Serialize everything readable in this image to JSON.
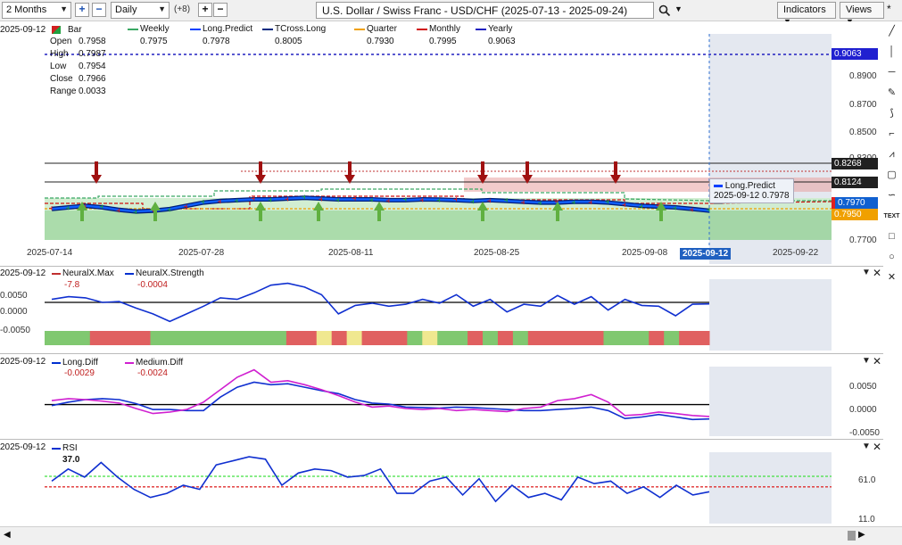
{
  "toolbar": {
    "range": "2 Months",
    "interval": "Daily",
    "offset": "(+8)",
    "symbol": "U.S. Dollar / Swiss Franc - USD/CHF (2025-07-13 - 2025-09-24)",
    "indicators": "Indicators",
    "views": "Views"
  },
  "main_pane": {
    "date": "2025-09-12",
    "bar_label": "Bar",
    "ohlc": [
      {
        "label": "Open",
        "value": "0.7958"
      },
      {
        "label": "High",
        "value": "0.7987"
      },
      {
        "label": "Low",
        "value": "0.7954"
      },
      {
        "label": "Close",
        "value": "0.7966"
      },
      {
        "label": "Range",
        "value": "0.0033"
      }
    ],
    "indicators": [
      {
        "name": "Weekly",
        "value": "0.7975",
        "color": "#3aa864"
      },
      {
        "name": "Long.Predict",
        "value": "0.7978",
        "color": "#0040ff"
      },
      {
        "name": "TCross.Long",
        "value": "0.8005",
        "color": "#002a80"
      },
      {
        "name": "Quarter",
        "value": "0.7930",
        "color": "#f0a000"
      },
      {
        "name": "Monthly",
        "value": "0.7995",
        "color": "#d01010"
      },
      {
        "name": "Yearly",
        "value": "0.9063",
        "color": "#2020c0"
      }
    ],
    "price_axis": [
      "0.8900",
      "0.8700",
      "0.8500",
      "0.8300",
      "0.7700"
    ],
    "price_tags": [
      {
        "value": "0.9063",
        "color": "#2020d0"
      },
      {
        "value": "0.8268",
        "color": "#202020"
      },
      {
        "value": "0.8124",
        "color": "#202020"
      },
      {
        "value": "0.7970",
        "color": "#1060d0"
      },
      {
        "value": "0.7950",
        "color": "#f0a000"
      }
    ],
    "dates": [
      "2025-07-14",
      "2025-07-28",
      "2025-08-11",
      "2025-08-25",
      "2025-09-08",
      "2025-09-12",
      "2025-09-22"
    ],
    "tooltip": {
      "name": "Long.Predict",
      "date": "2025-09-12",
      "value": "0.7978"
    }
  },
  "pane2": {
    "date": "2025-09-12",
    "legends": [
      {
        "name": "NeuralX.Max",
        "value": "-7.8",
        "color": "#c03030"
      },
      {
        "name": "NeuralX.Strength",
        "value": "-0.0004",
        "color": "#0030d0"
      }
    ],
    "axis": [
      "0.0050",
      "0.0000",
      "-0.0050"
    ]
  },
  "pane3": {
    "date": "2025-09-12",
    "legends": [
      {
        "name": "Long.Diff",
        "value": "-0.0029",
        "color": "#0030d0"
      },
      {
        "name": "Medium.Diff",
        "value": "-0.0024",
        "color": "#d020d0"
      }
    ],
    "axis": [
      "0.0050",
      "0.0000",
      "-0.0050"
    ]
  },
  "pane4": {
    "date": "2025-09-12",
    "legends": [
      {
        "name": "RSI",
        "value": "37.0",
        "color": "#0030d0"
      }
    ],
    "axis": [
      "61.0",
      "11.0"
    ]
  },
  "chart_data": [
    {
      "type": "line",
      "title": "U.S. Dollar / Swiss Franc - USD/CHF (2025-07-13 - 2025-09-24)",
      "series": [
        {
          "name": "Long.Predict",
          "values": [
            0.799,
            0.8,
            0.801,
            0.8,
            0.7985,
            0.7975,
            0.798,
            0.799,
            0.801,
            0.803,
            0.804,
            0.8045,
            0.805,
            0.805,
            0.8055,
            0.806,
            0.8055,
            0.805,
            0.805,
            0.805,
            0.8045,
            0.8045,
            0.805,
            0.8048,
            0.8045,
            0.804,
            0.8045,
            0.804,
            0.8035,
            0.803,
            0.803,
            0.8035,
            0.8035,
            0.803,
            0.802,
            0.801,
            0.8005,
            0.8,
            0.799,
            0.798
          ]
        }
      ],
      "reference_lines": {
        "Yearly": 0.9063,
        "upper_black": 0.8268,
        "lower_black": 0.8124
      },
      "ylim": [
        0.77,
        0.91
      ]
    },
    {
      "type": "line",
      "series": [
        {
          "name": "NeuralX.Strength",
          "values": [
            0.0008,
            0.0015,
            0.0012,
            0.0,
            0.0002,
            -0.0015,
            -0.003,
            -0.005,
            -0.003,
            -0.001,
            0.0012,
            0.0008,
            0.0025,
            0.0045,
            0.005,
            0.004,
            0.002,
            -0.003,
            -0.0008,
            -0.0002,
            -0.001,
            -0.0005,
            0.0008,
            -0.0002,
            0.002,
            -0.001,
            0.0008,
            -0.0025,
            -0.0005,
            -0.001,
            0.0018,
            -0.0005,
            0.0015,
            -0.002,
            0.0008,
            -0.0008,
            -0.001,
            -0.0035,
            -0.0005,
            -0.0004
          ]
        },
        {
          "name": "NeuralX.Max",
          "values": []
        }
      ],
      "ylim": [
        -0.007,
        0.007
      ]
    },
    {
      "type": "line",
      "series": [
        {
          "name": "Long.Diff",
          "values": [
            -0.0002,
            0.0005,
            0.001,
            0.0012,
            0.001,
            0.0002,
            -0.001,
            -0.001,
            -0.0012,
            -0.0012,
            0.0015,
            0.0035,
            0.0045,
            0.004,
            0.0042,
            0.0035,
            0.0028,
            0.0022,
            0.001,
            0.0003,
            0.0001,
            -0.0005,
            -0.0006,
            -0.0007,
            -0.0005,
            -0.0006,
            -0.0008,
            -0.001,
            -0.0012,
            -0.0012,
            -0.001,
            -0.0008,
            -0.0005,
            -0.0012,
            -0.0028,
            -0.0025,
            -0.002,
            -0.0025,
            -0.003,
            -0.0029
          ]
        },
        {
          "name": "Medium.Diff",
          "values": [
            0.0008,
            0.0012,
            0.001,
            0.0007,
            0.0003,
            -0.0008,
            -0.0018,
            -0.0015,
            -0.001,
            0.0005,
            0.003,
            0.0055,
            0.007,
            0.0045,
            0.0048,
            0.004,
            0.003,
            0.0018,
            0.0005,
            -0.0005,
            -0.0003,
            -0.0008,
            -0.001,
            -0.0008,
            -0.0012,
            -0.001,
            -0.0012,
            -0.0014,
            -0.0008,
            -0.0005,
            0.0008,
            0.0012,
            0.002,
            0.0005,
            -0.0022,
            -0.002,
            -0.0015,
            -0.0018,
            -0.0022,
            -0.0024
          ]
        }
      ],
      "ylim": [
        -0.006,
        0.008
      ]
    },
    {
      "type": "line",
      "series": [
        {
          "name": "RSI",
          "values": [
            55,
            70,
            60,
            78,
            60,
            45,
            35,
            40,
            50,
            45,
            75,
            80,
            85,
            82,
            50,
            65,
            70,
            68,
            60,
            62,
            70,
            40,
            40,
            55,
            60,
            38,
            58,
            30,
            50,
            35,
            40,
            32,
            60,
            52,
            55,
            40,
            48,
            35,
            50,
            38,
            42
          ]
        }
      ],
      "reference_lines": {
        "upper": 61,
        "lower": 48
      },
      "ylim": [
        5,
        95
      ]
    }
  ]
}
